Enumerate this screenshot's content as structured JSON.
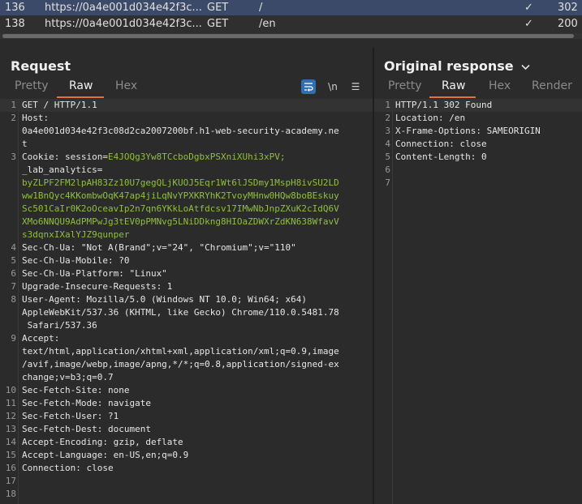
{
  "history": {
    "rows": [
      {
        "num": "136",
        "url": "https://0a4e001d034e42f3c...",
        "method": "GET",
        "path": "/",
        "check": "✓",
        "status": "302"
      },
      {
        "num": "138",
        "url": "https://0a4e001d034e42f3c...",
        "method": "GET",
        "path": "/en",
        "check": "✓",
        "status": "200"
      }
    ]
  },
  "request": {
    "title": "Request",
    "tabs": [
      "Pretty",
      "Raw",
      "Hex"
    ],
    "active_tab": "Raw",
    "wrap_icon": "wrap-lines-icon",
    "newline_label": "\\n",
    "menu_icon": "☰",
    "lines": [
      {
        "n": "1",
        "t": "GET / HTTP/1.1"
      },
      {
        "n": "2",
        "t": "Host:"
      },
      {
        "n": "",
        "t": "0a4e001d034e42f3c08d2ca2007200bf.h1-web-security-academy.ne"
      },
      {
        "n": "",
        "t": "t"
      },
      {
        "n": "3",
        "t": "Cookie: session=",
        "g": "E4JOQg3Yw8TCcboDgbxPSXniXUhi3xPV;"
      },
      {
        "n": "",
        "t": "_lab_analytics="
      },
      {
        "n": "",
        "g": "byZLPF2FM2lpAH83Zz10U7gegQLjKUOJ5Eqr1Wt6lJSDmy1MspH8ivSU2LD"
      },
      {
        "n": "",
        "g": "ww1BnQyc4KKombwOqK47ap4jiLqNvYPXKRYhK2TvoyMHnw0HQw8boBEskuy"
      },
      {
        "n": "",
        "g": "Sc501CaIr0K2oOceavIp2n7qn6YKkLoAtfdcsv17IMwNbJnpZXuK2cIdQ6V"
      },
      {
        "n": "",
        "g": "XMo6NNQU9AdPMPwJg3tEV0pPMNvg5LNiDDkng8HIOaZDWXrZdKN638WfavV"
      },
      {
        "n": "",
        "g": "s3dqnxIXalYJZ9qunper"
      },
      {
        "n": "4",
        "t": "Sec-Ch-Ua: \"Not A(Brand\";v=\"24\", \"Chromium\";v=\"110\""
      },
      {
        "n": "5",
        "t": "Sec-Ch-Ua-Mobile: ?0"
      },
      {
        "n": "6",
        "t": "Sec-Ch-Ua-Platform: \"Linux\""
      },
      {
        "n": "7",
        "t": "Upgrade-Insecure-Requests: 1"
      },
      {
        "n": "8",
        "t": "User-Agent: Mozilla/5.0 (Windows NT 10.0; Win64; x64)"
      },
      {
        "n": "",
        "t": "AppleWebKit/537.36 (KHTML, like Gecko) Chrome/110.0.5481.78"
      },
      {
        "n": "",
        "t": " Safari/537.36"
      },
      {
        "n": "9",
        "t": "Accept:"
      },
      {
        "n": "",
        "t": "text/html,application/xhtml+xml,application/xml;q=0.9,image"
      },
      {
        "n": "",
        "t": "/avif,image/webp,image/apng,*/*;q=0.8,application/signed-ex"
      },
      {
        "n": "",
        "t": "change;v=b3;q=0.7"
      },
      {
        "n": "10",
        "t": "Sec-Fetch-Site: none"
      },
      {
        "n": "11",
        "t": "Sec-Fetch-Mode: navigate"
      },
      {
        "n": "12",
        "t": "Sec-Fetch-User: ?1"
      },
      {
        "n": "13",
        "t": "Sec-Fetch-Dest: document"
      },
      {
        "n": "14",
        "t": "Accept-Encoding: gzip, deflate"
      },
      {
        "n": "15",
        "t": "Accept-Language: en-US,en;q=0.9"
      },
      {
        "n": "16",
        "t": "Connection: close"
      },
      {
        "n": "17",
        "t": ""
      },
      {
        "n": "18",
        "t": ""
      }
    ]
  },
  "response": {
    "title": "Original response",
    "dropdown_icon": "chevron-down-icon",
    "tabs": [
      "Pretty",
      "Raw",
      "Hex",
      "Render"
    ],
    "active_tab": "Raw",
    "lines": [
      {
        "n": "1",
        "t": "HTTP/1.1 302 Found"
      },
      {
        "n": "2",
        "t": "Location: /en"
      },
      {
        "n": "3",
        "t": "X-Frame-Options: SAMEORIGIN"
      },
      {
        "n": "4",
        "t": "Connection: close"
      },
      {
        "n": "5",
        "t": "Content-Length: 0"
      },
      {
        "n": "6",
        "t": ""
      },
      {
        "n": "7",
        "t": ""
      }
    ]
  },
  "colors": {
    "accent": "#e8703a",
    "selected_row": "#3b4a68",
    "cookie_value": "#8fbf3f",
    "wrap_button": "#2f6fb1"
  }
}
